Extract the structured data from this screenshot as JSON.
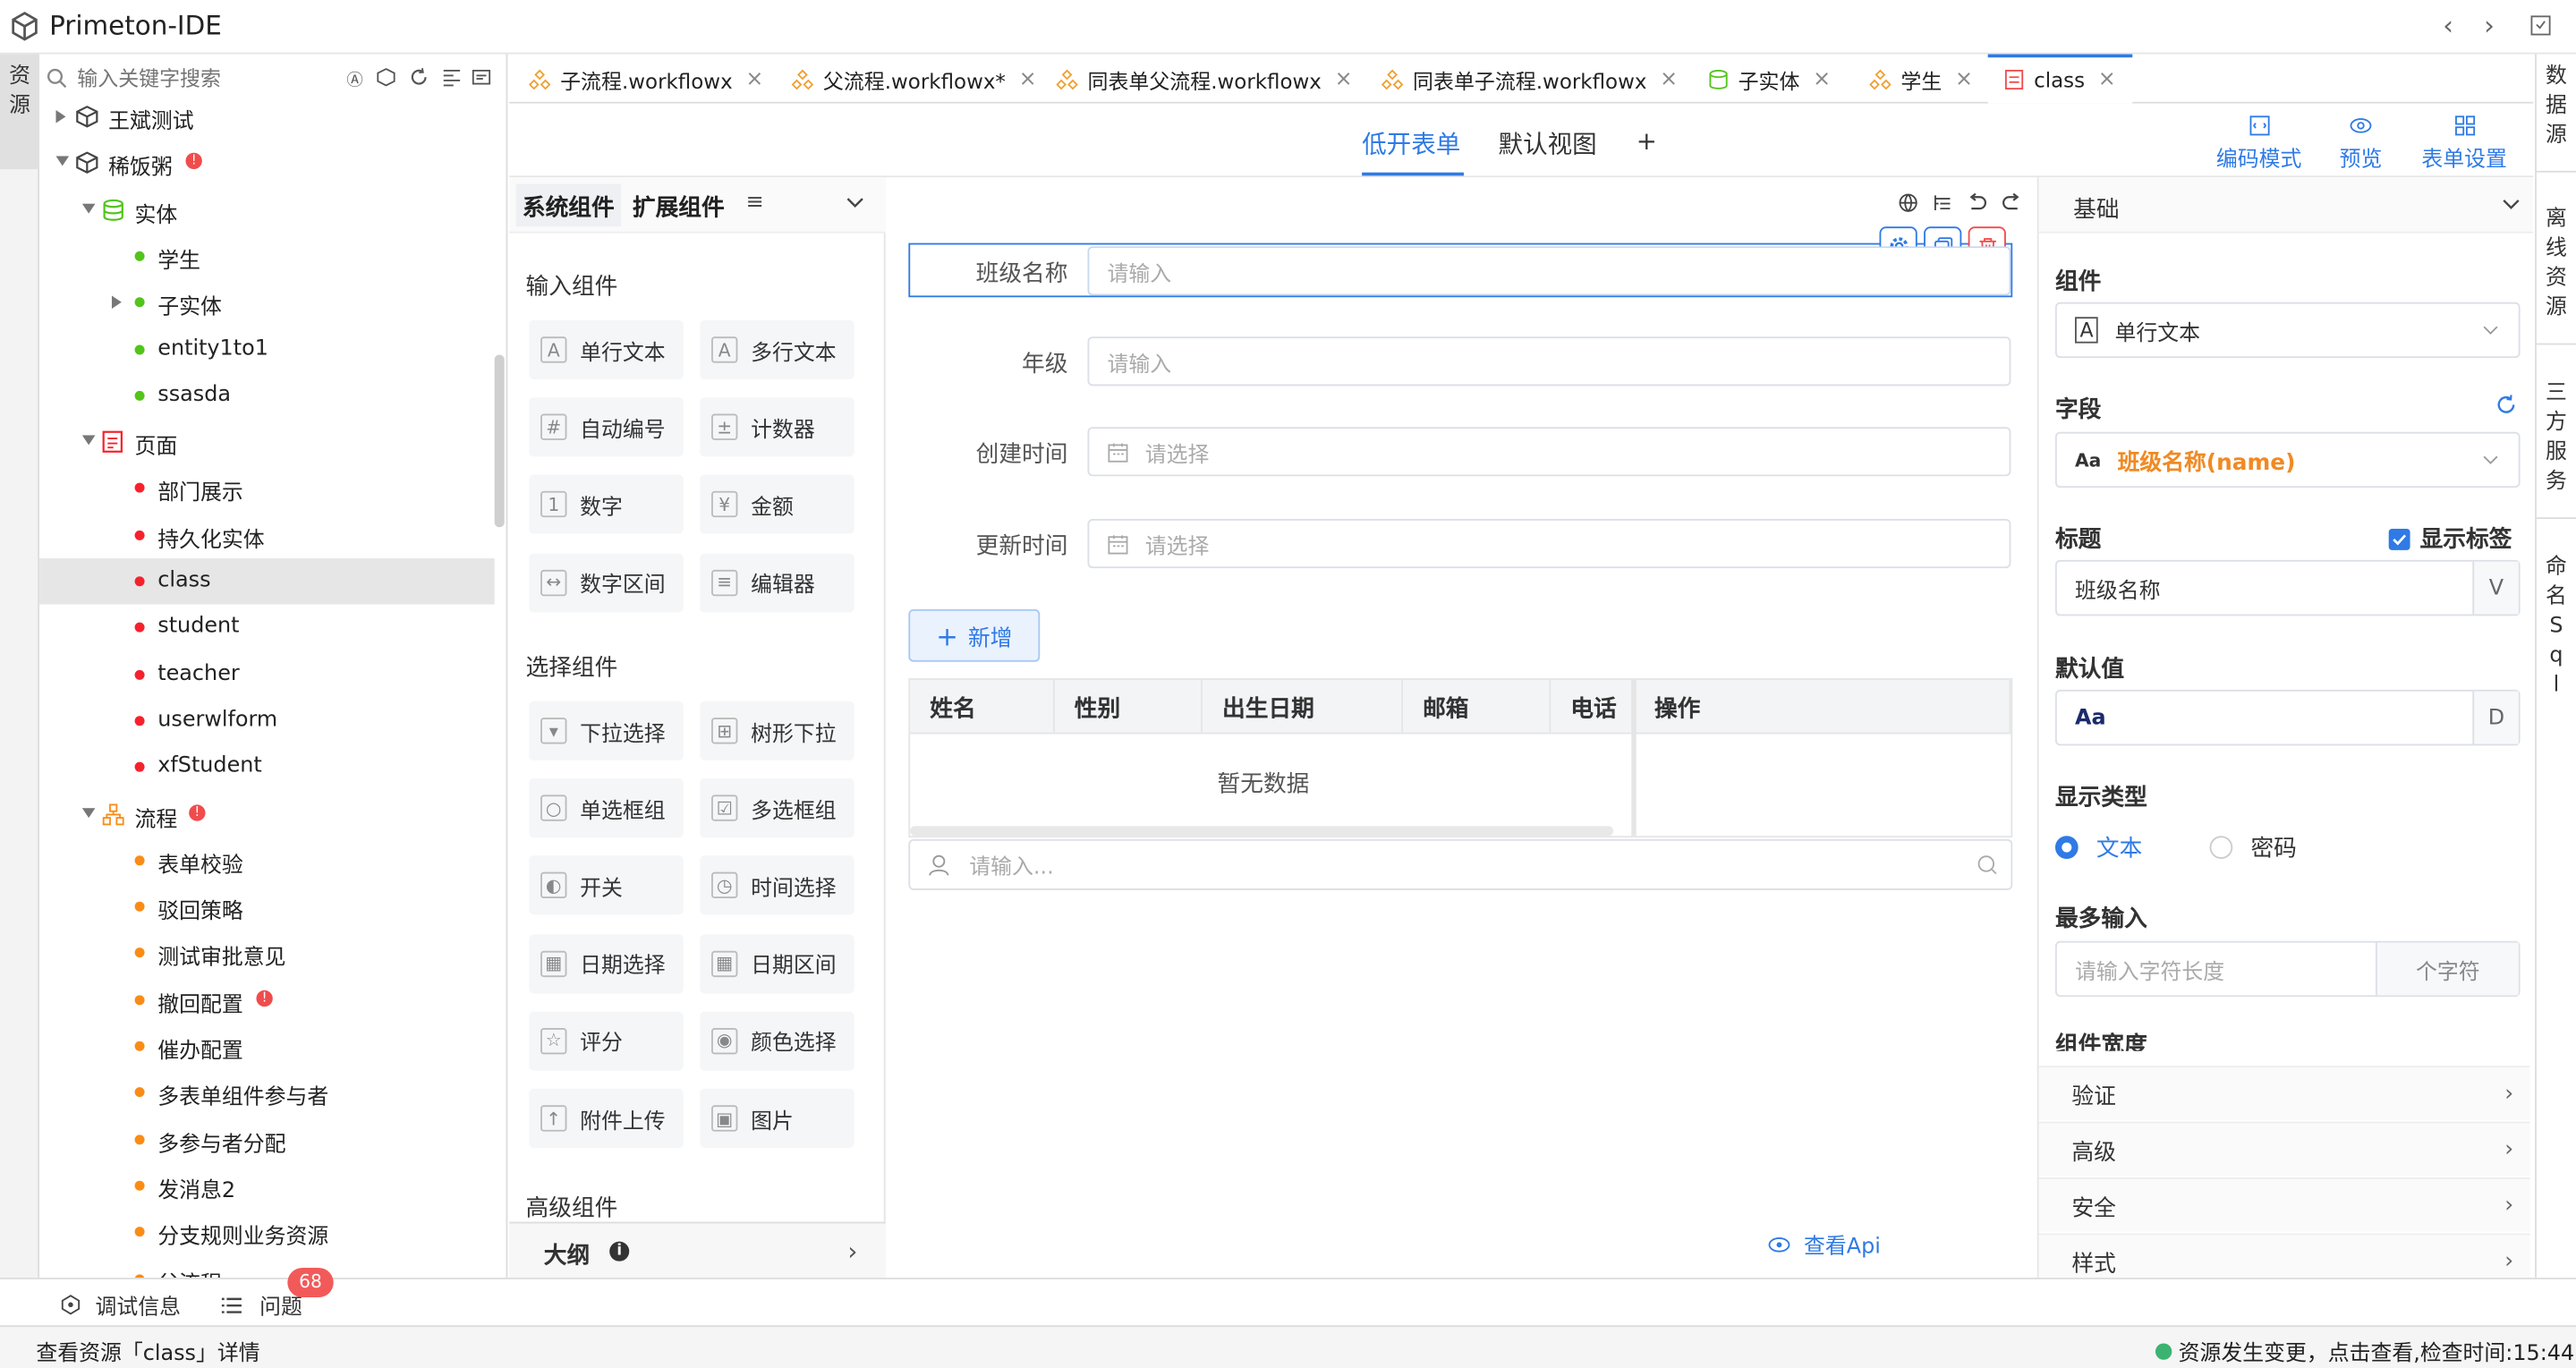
{
  "app": {
    "title": "Primeton-IDE"
  },
  "activity": {
    "resources": "资源"
  },
  "search": {
    "placeholder": "输入关键字搜索"
  },
  "tree": {
    "items": [
      {
        "label": "王斌测试",
        "level": 1,
        "type": "pkg",
        "badge": false,
        "expanded": false
      },
      {
        "label": "稀饭粥",
        "level": 1,
        "type": "pkg",
        "badge": true,
        "expanded": true
      },
      {
        "label": "实体",
        "level": 2,
        "type": "db",
        "badge": false,
        "expanded": true
      },
      {
        "label": "学生",
        "level": 3,
        "type": "dot",
        "color": "#52c41a"
      },
      {
        "label": "子实体",
        "level": 3,
        "type": "dot",
        "color": "#52c41a",
        "arrow": true
      },
      {
        "label": "entity1to1",
        "level": 3,
        "type": "dot",
        "color": "#52c41a"
      },
      {
        "label": "ssasda",
        "level": 3,
        "type": "dot",
        "color": "#52c41a"
      },
      {
        "label": "页面",
        "level": 2,
        "type": "page",
        "badge": false,
        "expanded": true
      },
      {
        "label": "部门展示",
        "level": 3,
        "type": "dot",
        "color": "#f5222d"
      },
      {
        "label": "持久化实体",
        "level": 3,
        "type": "dot",
        "color": "#f5222d"
      },
      {
        "label": "class",
        "level": 3,
        "type": "dot",
        "color": "#f5222d",
        "selected": true
      },
      {
        "label": "student",
        "level": 3,
        "type": "dot",
        "color": "#f5222d"
      },
      {
        "label": "teacher",
        "level": 3,
        "type": "dot",
        "color": "#f5222d"
      },
      {
        "label": "userwlform",
        "level": 3,
        "type": "dot",
        "color": "#f5222d"
      },
      {
        "label": "xfStudent",
        "level": 3,
        "type": "dot",
        "color": "#f5222d"
      },
      {
        "label": "流程",
        "level": 2,
        "type": "flow",
        "badge": true,
        "expanded": true
      },
      {
        "label": "表单校验",
        "level": 3,
        "type": "dot",
        "color": "#fa8c16"
      },
      {
        "label": "驳回策略",
        "level": 3,
        "type": "dot",
        "color": "#fa8c16"
      },
      {
        "label": "测试审批意见",
        "level": 3,
        "type": "dot",
        "color": "#fa8c16"
      },
      {
        "label": "撤回配置",
        "level": 3,
        "type": "dot",
        "color": "#fa8c16",
        "badge": true
      },
      {
        "label": "催办配置",
        "level": 3,
        "type": "dot",
        "color": "#fa8c16"
      },
      {
        "label": "多表单组件参与者",
        "level": 3,
        "type": "dot",
        "color": "#fa8c16"
      },
      {
        "label": "多参与者分配",
        "level": 3,
        "type": "dot",
        "color": "#fa8c16"
      },
      {
        "label": "发消息2",
        "level": 3,
        "type": "dot",
        "color": "#fa8c16"
      },
      {
        "label": "分支规则业务资源",
        "level": 3,
        "type": "dot",
        "color": "#fa8c16"
      },
      {
        "label": "父流程",
        "level": 3,
        "type": "dot",
        "color": "#fa8c16"
      }
    ]
  },
  "tabs": [
    {
      "label": "子流程.workflowx",
      "icon": "workflow-icon"
    },
    {
      "label": "父流程.workflowx*",
      "icon": "workflow-icon"
    },
    {
      "label": "同表单父流程.workflowx",
      "icon": "workflow-icon"
    },
    {
      "label": "同表单子流程.workflowx",
      "icon": "workflow-icon"
    },
    {
      "label": "子实体",
      "icon": "entity-icon"
    },
    {
      "label": "学生",
      "icon": "workflow-icon"
    },
    {
      "label": "class",
      "icon": "page-icon",
      "active": true
    }
  ],
  "views": {
    "lowcode": "低开表单",
    "default": "默认视图",
    "add": "+"
  },
  "toolbar": {
    "code_mode": "编码模式",
    "preview": "预览",
    "form_settings": "表单设置"
  },
  "palette": {
    "tab_system": "系统组件",
    "tab_ext": "扩展组件",
    "menu": "≡",
    "groups": [
      {
        "title": "输入组件",
        "items": [
          "单行文本",
          "多行文本",
          "自动编号",
          "计数器",
          "数字",
          "金额",
          "数字区间",
          "编辑器"
        ]
      },
      {
        "title": "选择组件",
        "items": [
          "下拉选择",
          "树形下拉",
          "单选框组",
          "多选框组",
          "开关",
          "时间选择",
          "日期选择",
          "日期区间",
          "评分",
          "颜色选择",
          "附件上传",
          "图片"
        ]
      },
      {
        "title": "高级组件",
        "items": []
      }
    ],
    "outline": "大纲"
  },
  "form": {
    "fields": [
      {
        "label": "班级名称",
        "placeholder": "请输入",
        "date": false,
        "selected": true
      },
      {
        "label": "年级",
        "placeholder": "请输入",
        "date": false
      },
      {
        "label": "创建时间",
        "placeholder": "请选择",
        "date": true
      },
      {
        "label": "更新时间",
        "placeholder": "请选择",
        "date": true
      }
    ],
    "add_button": "新增",
    "table": {
      "columns": [
        "姓名",
        "性别",
        "出生日期",
        "邮箱",
        "电话",
        "操作"
      ],
      "empty": "暂无数据"
    },
    "user_search_placeholder": "请输入...",
    "view_api": "查看Api"
  },
  "props": {
    "header": "基础",
    "component_label": "组件",
    "component_value": "单行文本",
    "field_label": "字段",
    "field_value": "班级名称(name)",
    "field_prefix": "Aa",
    "title_label": "标题",
    "show_label": "显示标签",
    "title_value": "班级名称",
    "title_suffix": "V",
    "default_label": "默认值",
    "default_value": "Aa",
    "default_suffix": "D",
    "display_type_label": "显示类型",
    "opt_text": "文本",
    "opt_password": "密码",
    "max_input_label": "最多输入",
    "max_input_placeholder": "请输入字符长度",
    "max_input_suffix": "个字符",
    "width_label": "组件宽度",
    "sections": [
      "验证",
      "高级",
      "安全",
      "样式"
    ]
  },
  "right_rail": [
    "数据源",
    "离线资源",
    "三方服务",
    "命名Sql"
  ],
  "bottom": {
    "debug": "调试信息",
    "issues": "问题",
    "issues_count": "68"
  },
  "status": {
    "left": "查看资源「class」详情",
    "right": "资源发生变更，点击查看,检查时间:15:44"
  },
  "colors": {
    "accent": "#2f7ae5",
    "orange": "#f08a24",
    "red": "#f04c4c",
    "green": "#3cb371"
  }
}
